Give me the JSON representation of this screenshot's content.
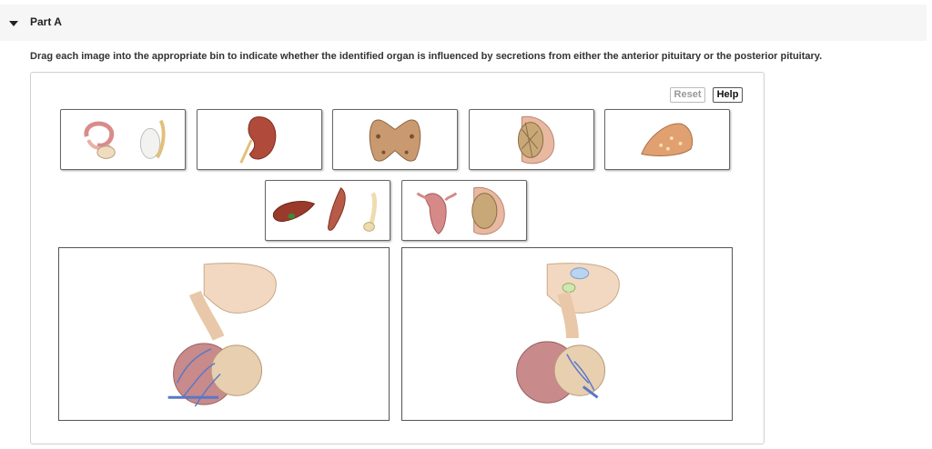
{
  "part": {
    "title": "Part A"
  },
  "instructions": "Drag each image into the appropriate bin to indicate whether the identified organ is influenced by secretions from either the anterior pituitary or the posterior pituitary.",
  "buttons": {
    "reset": "Reset",
    "help": "Help"
  },
  "draggables": [
    {
      "icon": "ovary-testis-icon"
    },
    {
      "icon": "kidney-icon"
    },
    {
      "icon": "thyroid-icon"
    },
    {
      "icon": "breast-icon"
    },
    {
      "icon": "adrenal-cortex-icon"
    },
    {
      "icon": "liver-muscle-bone-icon"
    },
    {
      "icon": "uterus-breast-icon"
    }
  ],
  "bins": [
    {
      "icon": "anterior-pituitary-icon"
    },
    {
      "icon": "posterior-pituitary-icon"
    }
  ]
}
